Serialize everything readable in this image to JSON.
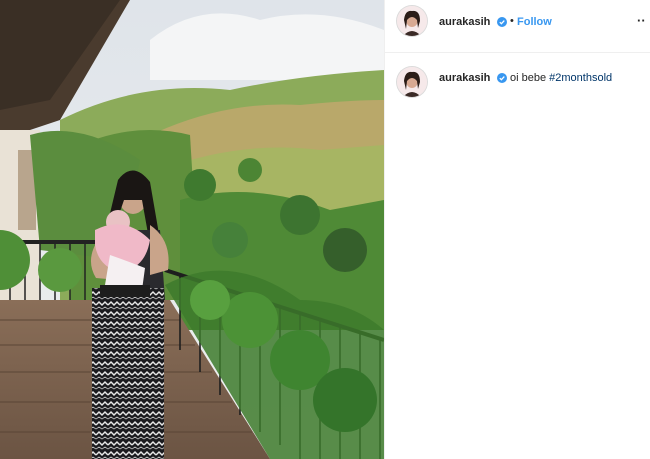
{
  "post": {
    "image_alt": "Woman holding a baby on a wooden balcony overlooking green hills"
  },
  "header": {
    "username": "aurakasih",
    "separator": "•",
    "follow_label": "Follow",
    "more_icon": "more-options-icon",
    "more_label": "··"
  },
  "caption": {
    "username": "aurakasih",
    "text": "oi bebe",
    "hashtag": "#2monthsold"
  },
  "colors": {
    "link": "#3897f0",
    "hashtag": "#003569",
    "verified": "#3897f0"
  }
}
